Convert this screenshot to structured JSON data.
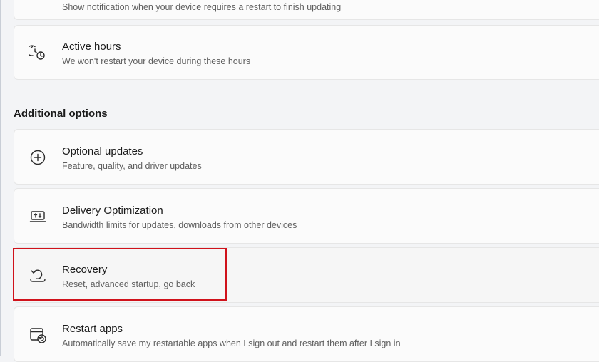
{
  "top_card": {
    "subtitle": "Show notification when your device requires a restart to finish updating"
  },
  "active_hours": {
    "title": "Active hours",
    "subtitle": "We won't restart your device during these hours",
    "icon": "active-hours-clock-icon"
  },
  "additional_options": {
    "heading": "Additional options",
    "items": [
      {
        "title": "Optional updates",
        "subtitle": "Feature, quality, and driver updates",
        "icon": "plus-circle-icon"
      },
      {
        "title": "Delivery Optimization",
        "subtitle": "Bandwidth limits for updates, downloads from other devices",
        "icon": "delivery-optimization-icon"
      },
      {
        "title": "Recovery",
        "subtitle": "Reset, advanced startup, go back",
        "icon": "recovery-icon",
        "highlighted": true,
        "highlight_color": "#d0121b"
      },
      {
        "title": "Restart apps",
        "subtitle": "Automatically save my restartable apps when I sign out and restart them after I sign in",
        "icon": "restart-apps-icon"
      }
    ]
  },
  "colors": {
    "page_background": "#f3f4f6",
    "card_background": "#fbfbfb",
    "highlight_border": "#d0121b"
  }
}
